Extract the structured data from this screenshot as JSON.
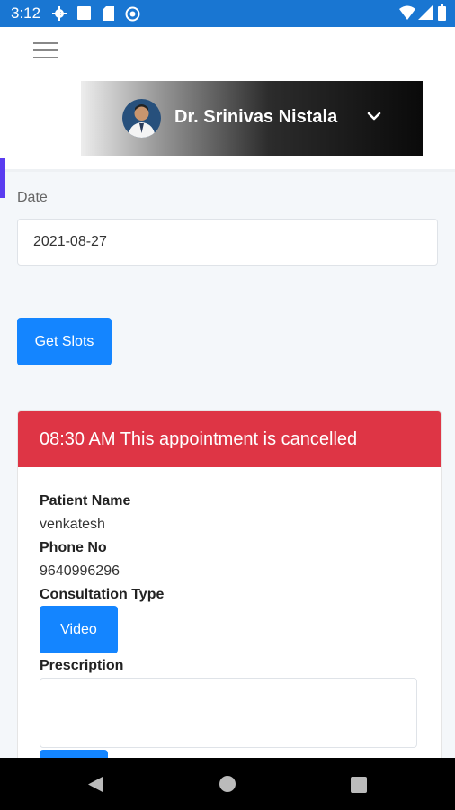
{
  "status_bar": {
    "time": "3:12"
  },
  "doctor": {
    "name": "Dr. Srinivas Nistala"
  },
  "form": {
    "date_label": "Date",
    "date_value": "2021-08-27",
    "get_slots_label": "Get Slots"
  },
  "appointment": {
    "header": "08:30 AM This appointment is cancelled",
    "patient_name_label": "Patient Name",
    "patient_name": "venkatesh",
    "phone_label": "Phone No",
    "phone": "9640996296",
    "consultation_type_label": "Consultation Type",
    "consultation_type": "Video",
    "prescription_label": "Prescription"
  }
}
